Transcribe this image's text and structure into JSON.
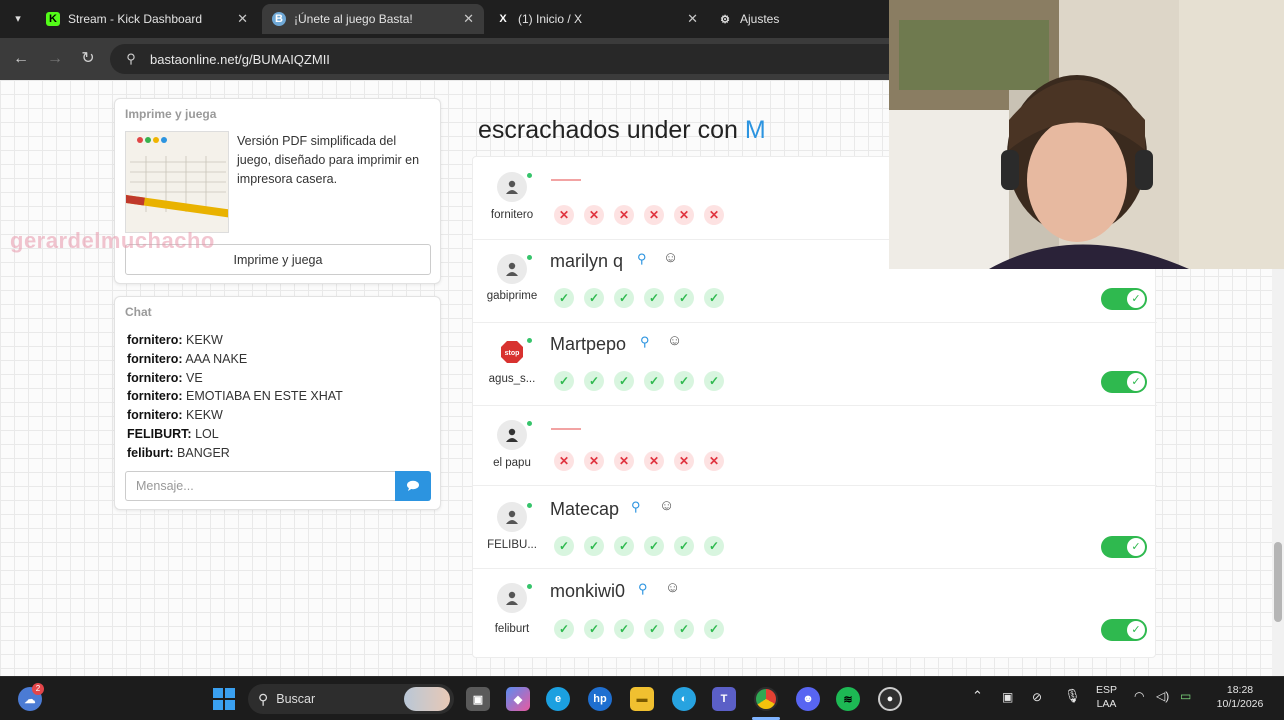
{
  "browser": {
    "tabs": [
      {
        "label": "Stream - Kick Dashboard",
        "icon": "kick-icon",
        "glyph": "K"
      },
      {
        "label": "¡Únete al juego Basta!",
        "icon": "basta-icon",
        "glyph": "B"
      },
      {
        "label": "(1) Inicio / X",
        "icon": "x-logo-icon",
        "glyph": "X"
      },
      {
        "label": "Ajustes",
        "icon": "gear-icon",
        "glyph": "⚙"
      }
    ],
    "url": "bastaonline.net/g/BUMAIQZMII"
  },
  "print_card": {
    "header": "Imprime y juega",
    "description": "Versión PDF simplificada del juego, diseñado para imprimir en impresora casera.",
    "button": "Imprime y juega",
    "watermark": "gerardelmuchacho"
  },
  "chat": {
    "header": "Chat",
    "messages": [
      {
        "user": "fornitero:",
        "text": "KEKW"
      },
      {
        "user": "fornitero:",
        "text": "AAA NAKE"
      },
      {
        "user": "fornitero:",
        "text": "VE"
      },
      {
        "user": "fornitero:",
        "text": "EMOTIABA EN ESTE XHAT"
      },
      {
        "user": "fornitero:",
        "text": "KEKW"
      },
      {
        "user": "FELIBURT:",
        "text": "LOL"
      },
      {
        "user": "feliburt:",
        "text": "BANGER"
      }
    ],
    "input_placeholder": "Mensaje..."
  },
  "main": {
    "title": "escrachados under con",
    "letter": "M"
  },
  "players": [
    {
      "username": "fornitero",
      "answer": "",
      "marks": [
        "x",
        "x",
        "x",
        "x",
        "x",
        "x"
      ],
      "toggle": false
    },
    {
      "username": "gabiprime",
      "answer": "marilyn q",
      "marks": [
        "ok",
        "ok",
        "ok",
        "ok",
        "ok",
        "ok"
      ],
      "toggle": true
    },
    {
      "username": "agus_s...",
      "answer": "Martpepo",
      "marks": [
        "ok",
        "ok",
        "ok",
        "ok",
        "ok",
        "ok"
      ],
      "toggle": true
    },
    {
      "username": "el papu",
      "answer": "",
      "marks": [
        "x",
        "x",
        "x",
        "x",
        "x",
        "x"
      ],
      "toggle": false
    },
    {
      "username": "FELIBU...",
      "answer": "Matecap",
      "marks": [
        "ok",
        "ok",
        "ok",
        "ok",
        "ok",
        "ok"
      ],
      "toggle": true
    },
    {
      "username": "feliburt",
      "answer": "monkiwi0",
      "marks": [
        "ok",
        "ok",
        "ok",
        "ok",
        "ok",
        "ok"
      ],
      "toggle": true
    }
  ],
  "taskbar": {
    "search_label": "Buscar",
    "weather_badge": "2",
    "lang_top": "ESP",
    "lang_bottom": "LAA",
    "time": "18:28",
    "date": "10/1/2026"
  },
  "colors": {
    "accent_blue": "#2c94e0",
    "ok_green": "#2fb94f",
    "error_red": "#e0343f"
  }
}
